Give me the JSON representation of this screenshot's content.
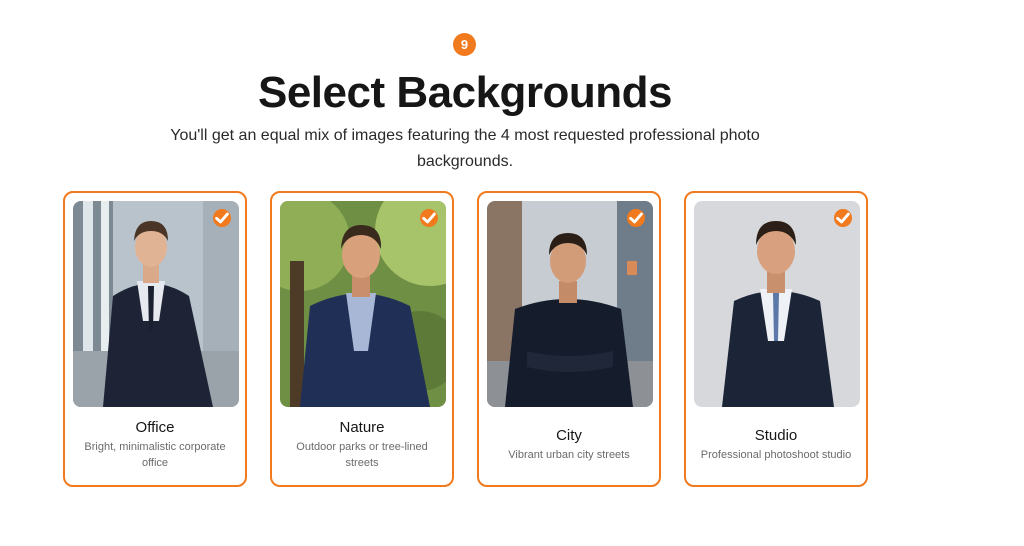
{
  "step": {
    "number": "9"
  },
  "header": {
    "title": "Select Backgrounds",
    "subtitle": "You'll get an equal mix of images featuring the 4 most requested professional photo backgrounds."
  },
  "cards": [
    {
      "title": "Office",
      "description": "Bright, minimalistic corporate office",
      "selected": true,
      "icon": "check-icon"
    },
    {
      "title": "Nature",
      "description": "Outdoor parks or tree-lined streets",
      "selected": true,
      "icon": "check-icon"
    },
    {
      "title": "City",
      "description": "Vibrant urban city streets",
      "selected": true,
      "icon": "check-icon"
    },
    {
      "title": "Studio",
      "description": "Professional photoshoot studio",
      "selected": true,
      "icon": "check-icon"
    }
  ],
  "colors": {
    "accent": "#f07a1d",
    "text": "#161616",
    "muted": "#6b6b6b"
  }
}
